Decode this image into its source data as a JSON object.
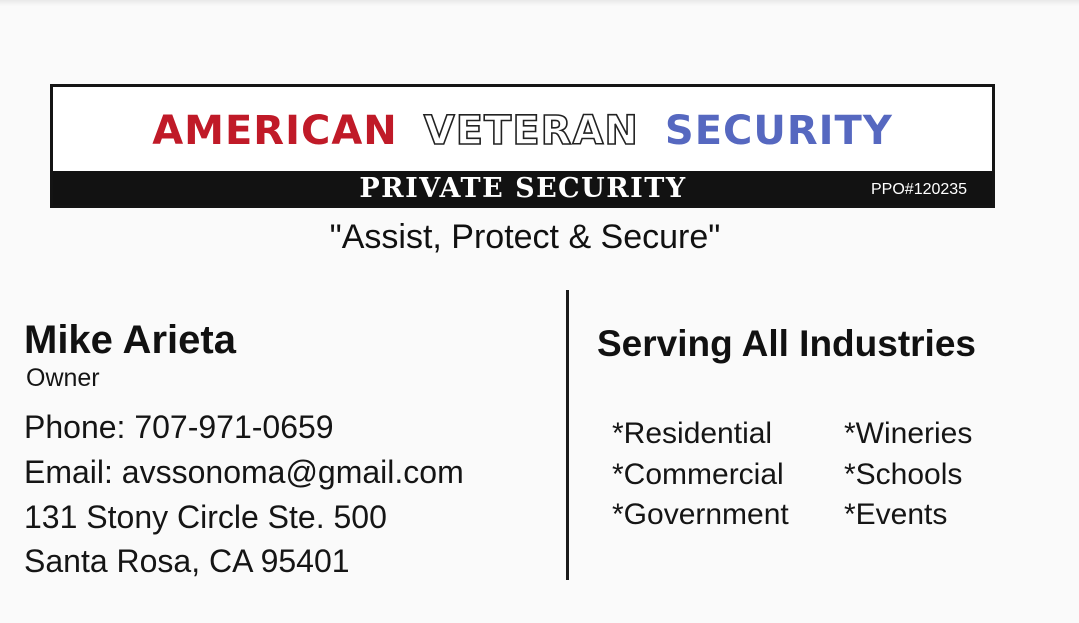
{
  "logo": {
    "word1": "AMERICAN",
    "word2": "VETERAN",
    "word3": "SECURITY",
    "band_title": "PRIVATE SECURITY",
    "license": "PPO#120235"
  },
  "tagline": "\"Assist, Protect & Secure\"",
  "contact": {
    "name": "Mike Arieta",
    "role": "Owner",
    "phone": "Phone: 707-971-0659",
    "email": "Email: avssonoma@gmail.com",
    "address_line1": "131 Stony Circle Ste. 500",
    "address_line2": "Santa Rosa, CA 95401"
  },
  "services": {
    "heading": "Serving All Industries",
    "items": [
      "*Residential",
      "*Commercial",
      "*Government",
      "*Wineries",
      "*Schools",
      "*Events"
    ]
  },
  "colors": {
    "american_red": "#c01a28",
    "security_blue": "#5668c0",
    "band_black": "#121212"
  }
}
